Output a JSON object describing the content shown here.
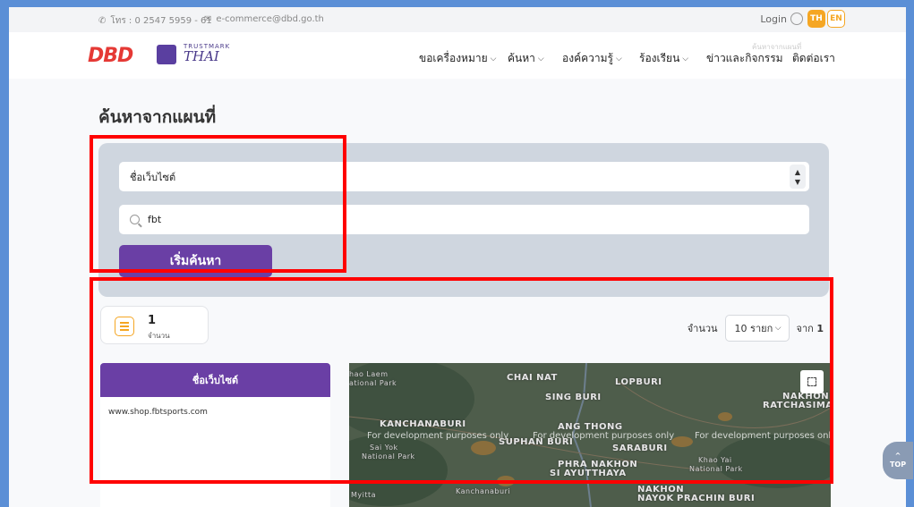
{
  "topbar": {
    "phone": "โทร : 0 2547 5959 - 61",
    "email": "e-commerce@dbd.go.th",
    "login": "Login",
    "lang_th": "TH",
    "lang_en": "EN"
  },
  "nav": {
    "logo_dbd": "DBD",
    "logo_trustmark": "TRUSTMARK",
    "logo_thai": "THAI",
    "ghost_text": "ค้นหาจากแผนที่",
    "items": [
      {
        "label": "ขอเครื่องหมาย",
        "dropdown": true
      },
      {
        "label": "ค้นหา",
        "dropdown": true
      },
      {
        "label": "องค์ความรู้",
        "dropdown": true
      },
      {
        "label": "ร้องเรียน",
        "dropdown": true
      },
      {
        "label": "ข่าวและกิจกรรม",
        "dropdown": false
      },
      {
        "label": "ติดต่อเรา",
        "dropdown": false
      }
    ]
  },
  "page": {
    "title": "ค้นหาจากแผนที่"
  },
  "search": {
    "type_value": "ชื่อเว็บไซต์",
    "query_value": "fbt",
    "button_label": "เริ่มค้นหา"
  },
  "results": {
    "count": "1",
    "count_label": "จำนวน",
    "pager_label": "จำนวน",
    "per_page": "10 รายก",
    "of_label": "จาก",
    "total_pages": "1",
    "column_header": "ชื่อเว็บไซต์",
    "rows": [
      "www.shop.fbtsports.com"
    ]
  },
  "map": {
    "dev_notice": "For development purposes only",
    "labels": {
      "chai_nat": "CHAI NAT",
      "lopburi": "LOPBURI",
      "sing_buri": "SING BURI",
      "nakhon_ratchasima_1": "NAKHON",
      "nakhon_ratchasima_2": "RATCHASIMA",
      "kanchanaburi": "KANCHANABURI",
      "ang_thong": "ANG THONG",
      "suphan_buri": "SUPHAN BURI",
      "saraburi": "SARABURI",
      "phra_nakhon_1": "PHRA NAKHON",
      "phra_nakhon_2": "SI AYUTTHAYA",
      "khao_yai_1": "Khao Yai",
      "khao_yai_2": "National Park",
      "nakhon_nayok_1": "NAKHON",
      "nakhon_nayok_2": "NAYOK",
      "prachin_buri": "PRACHIN BURI",
      "khao_laem_1": "hao Laem",
      "khao_laem_2": "ational Park",
      "sai_yok_1": "Sai Yok",
      "sai_yok_2": "National Park",
      "myitta": "Myitta",
      "kanchanaburi_town": "Kanchanaburi"
    }
  },
  "scroll_top": {
    "label": "TOP"
  },
  "colors": {
    "brand_purple": "#6a3fa5",
    "accent_orange": "#f5a623",
    "highlight_red": "#ff0000"
  }
}
